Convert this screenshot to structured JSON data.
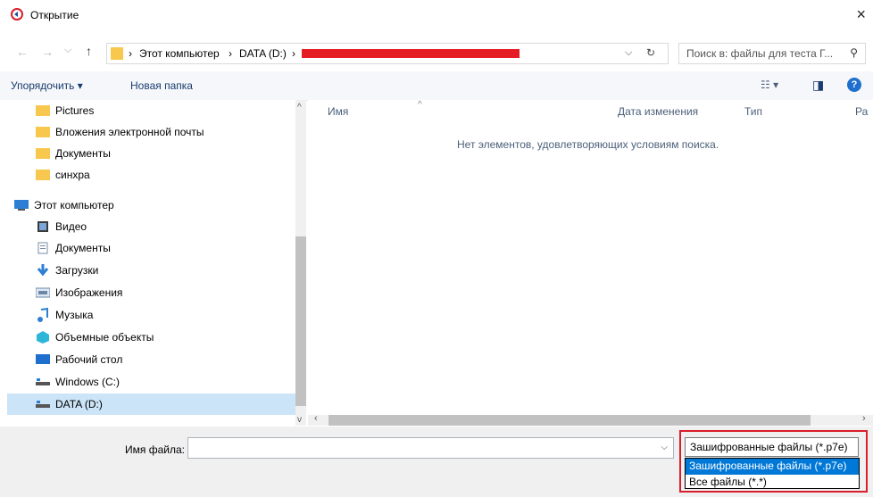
{
  "window": {
    "title": "Открытие",
    "close_glyph": "×"
  },
  "nav": {
    "back": "←",
    "forward": "→",
    "up": "↑",
    "dropdown": "⌵"
  },
  "address": {
    "crumbs": [
      "Этот компьютер",
      "DATA (D:)"
    ],
    "sep": "›",
    "refresh": "↻",
    "dropdown": "⌵"
  },
  "search": {
    "placeholder": "Поиск в: файлы для теста Г...",
    "icon": "⚲"
  },
  "toolbar": {
    "organize": "Упорядочить ▾",
    "new_folder": "Новая папка",
    "view": "☷ ▾",
    "preview": "◨",
    "help": "?"
  },
  "sidebar": {
    "items": [
      {
        "label": "Pictures",
        "icon": "folder-icon"
      },
      {
        "label": "Вложения электронной почты",
        "icon": "folder-icon"
      },
      {
        "label": "Документы",
        "icon": "folder-icon"
      },
      {
        "label": "синхра",
        "icon": "folder-icon"
      },
      {
        "label": "Этот компьютер",
        "icon": "computer-icon"
      },
      {
        "label": "Видео",
        "icon": "video-icon"
      },
      {
        "label": "Документы",
        "icon": "documents-icon"
      },
      {
        "label": "Загрузки",
        "icon": "downloads-icon"
      },
      {
        "label": "Изображения",
        "icon": "pictures-icon"
      },
      {
        "label": "Музыка",
        "icon": "music-icon"
      },
      {
        "label": "Объемные объекты",
        "icon": "3d-objects-icon"
      },
      {
        "label": "Рабочий стол",
        "icon": "desktop-icon"
      },
      {
        "label": "Windows (C:)",
        "icon": "drive-icon"
      },
      {
        "label": "DATA (D:)",
        "icon": "drive-icon"
      }
    ]
  },
  "columns": {
    "name": "Имя",
    "date": "Дата изменения",
    "type": "Тип",
    "size": "Ра"
  },
  "empty_message": "Нет элементов, удовлетворяющих условиям поиска.",
  "filename": {
    "label": "Имя файла:",
    "value": ""
  },
  "filter": {
    "selected": "Зашифрованные файлы (*.p7e)",
    "options": [
      "Зашифрованные файлы (*.p7e)",
      "Все файлы (*.*)"
    ]
  },
  "colors": {
    "accent": "#0078d7",
    "highlight": "#d81e2b",
    "folder": "#f8c84e"
  }
}
